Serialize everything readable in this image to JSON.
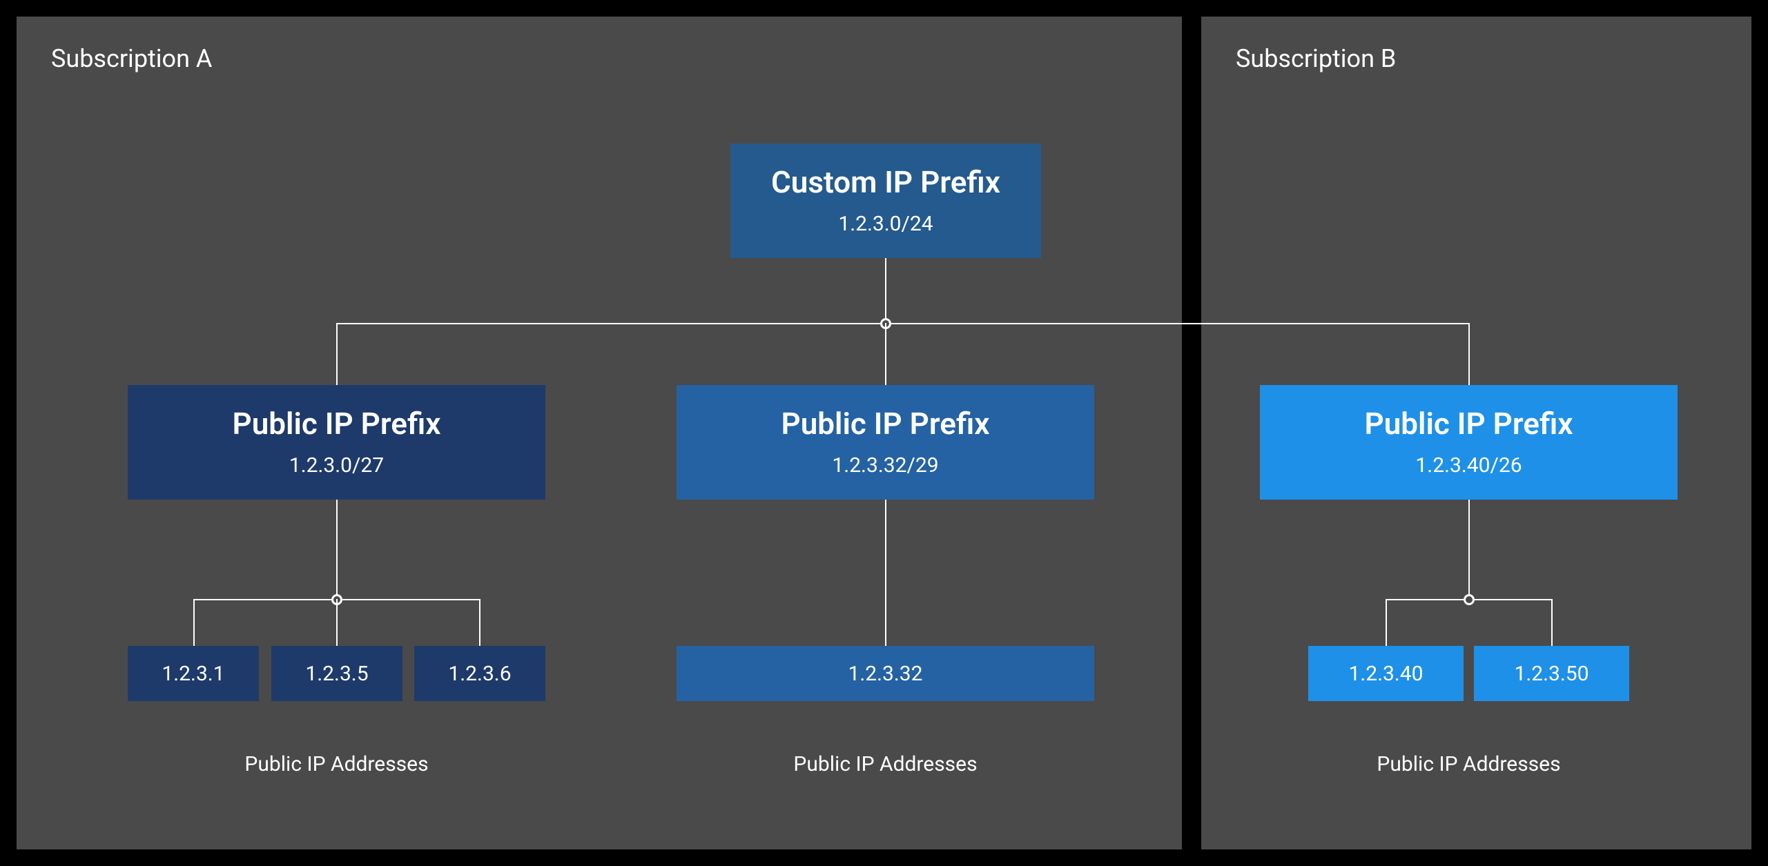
{
  "subscriptions": {
    "a": {
      "title": "Subscription A"
    },
    "b": {
      "title": "Subscription B"
    }
  },
  "nodes": {
    "custom_prefix": {
      "title": "Custom IP Prefix",
      "cidr": "1.2.3.0/24"
    },
    "prefix1": {
      "title": "Public IP Prefix",
      "cidr": "1.2.3.0/27"
    },
    "prefix2": {
      "title": "Public IP Prefix",
      "cidr": "1.2.3.32/29"
    },
    "prefix3": {
      "title": "Public IP Prefix",
      "cidr": "1.2.3.40/26"
    }
  },
  "addresses": {
    "group1": [
      "1.2.3.1",
      "1.2.3.5",
      "1.2.3.6"
    ],
    "group2": [
      "1.2.3.32"
    ],
    "group3": [
      "1.2.3.40",
      "1.2.3.50"
    ]
  },
  "captions": {
    "addresses": "Public IP Addresses"
  }
}
